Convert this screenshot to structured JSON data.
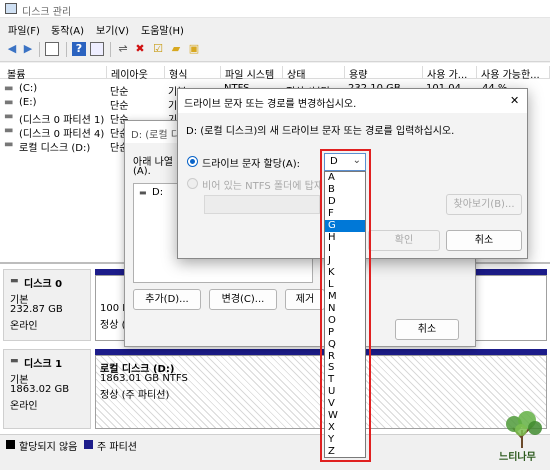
{
  "window": {
    "title": "디스크 관리"
  },
  "menu": [
    "파일(F)",
    "동작(A)",
    "보기(V)",
    "도움말(H)"
  ],
  "toolbar_icons": [
    "back-icon",
    "forward-icon",
    "list-view-icon",
    "help-icon",
    "properties-icon",
    "connect-icon",
    "delete-icon",
    "check-icon",
    "open-folder-icon",
    "explore-icon"
  ],
  "columns": [
    "볼륨",
    "레이아웃",
    "형식",
    "파일 시스템",
    "상태",
    "용량",
    "사용 가...",
    "사용 가능한..."
  ],
  "volumes": [
    {
      "name": "(C:)",
      "layout": "단순",
      "type": "기본",
      "fs": "NTFS",
      "status": "정상 (부팅...",
      "capacity": "232.10 GB",
      "free": "101.04 ...",
      "pct": "44 %"
    },
    {
      "name": "(E:)",
      "layout": "단순",
      "type": "기본",
      "fs": "",
      "status": "",
      "capacity": "",
      "free": "",
      "pct": ""
    },
    {
      "name": "(디스크 0 파티션 1)",
      "layout": "단순",
      "type": "기본",
      "fs": "",
      "status": "",
      "capacity": "",
      "free": "",
      "pct": ""
    },
    {
      "name": "(디스크 0 파티션 4)",
      "layout": "단순",
      "type": "기본",
      "fs": "",
      "status": "",
      "capacity": "",
      "free": "",
      "pct": ""
    },
    {
      "name": "로컬 디스크 (D:)",
      "layout": "단순",
      "type": "기본",
      "fs": "",
      "status": "",
      "capacity": "",
      "free": "",
      "pct": ""
    }
  ],
  "disks": [
    {
      "label": "디스크 0",
      "kind": "기본",
      "size": "232.87 GB",
      "state": "온라인",
      "part_line1": "100 N",
      "part_line2": "정상 ("
    },
    {
      "label": "디스크 1",
      "kind": "기본",
      "size": "1863.02 GB",
      "state": "온라인",
      "part_title": "로컬 디스크  (D:)",
      "part_line1": "1863.01 GB NTFS",
      "part_line2": "정상 (주 파티션)"
    }
  ],
  "legend": [
    "할당되지 않음",
    "주 파티션"
  ],
  "back_dialog": {
    "title": "D: (로컬 디스크",
    "text": "아래 나열",
    "text2": "(A).",
    "list_item": "D:",
    "buttons": {
      "add": "추가(D)...",
      "change": "변경(C)...",
      "remove": "제거",
      "cancel": "취소"
    }
  },
  "front_dialog": {
    "title": "드라이브 문자 또는 경로를 변경하십시오.",
    "prompt": "D: (로컬 디스크)의 새 드라이브 문자 또는 경로를 입력하십시오.",
    "opt_assign": "드라이브 문자 할당(A):",
    "opt_mount": "비어 있는 NTFS 폴더에 탑재",
    "browse": "찾아보기(B)...",
    "ok": "확인",
    "cancel": "취소",
    "close": "✕"
  },
  "dropdown": {
    "selected": "D",
    "highlighted": "G",
    "options": [
      "A",
      "B",
      "D",
      "F",
      "G",
      "H",
      "I",
      "J",
      "K",
      "L",
      "M",
      "N",
      "O",
      "P",
      "Q",
      "R",
      "S",
      "T",
      "U",
      "V",
      "W",
      "X",
      "Y",
      "Z"
    ]
  },
  "watermark": "느티나무",
  "colors": {
    "primary_partition": "#1c1c8a",
    "unallocated": "#000000",
    "highlight": "#0078d7",
    "annotation_red": "#e02020"
  }
}
